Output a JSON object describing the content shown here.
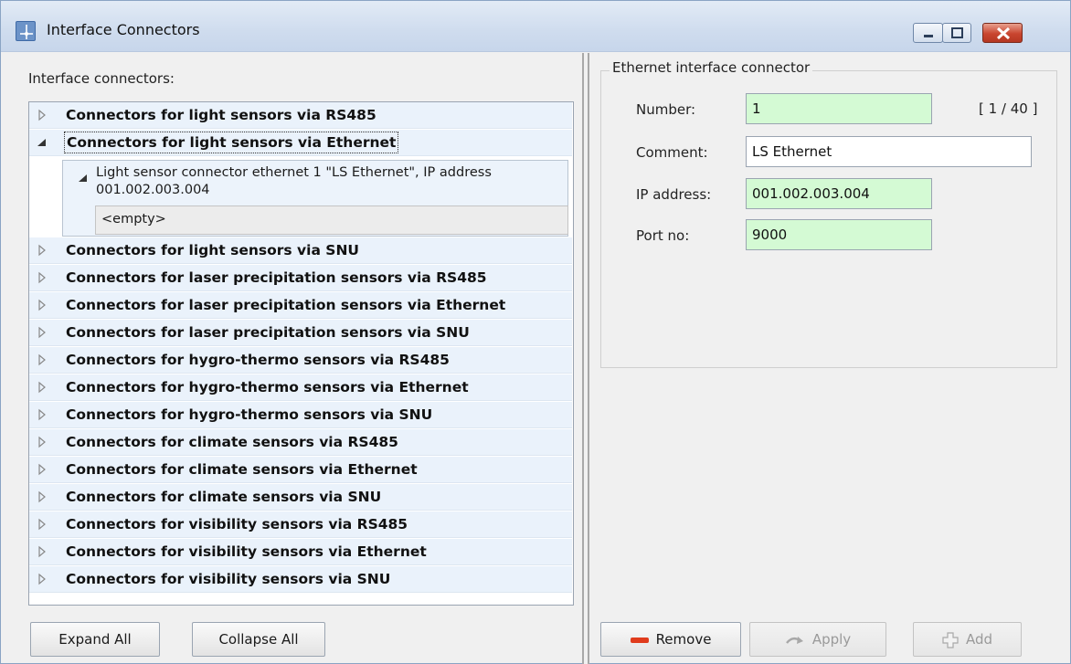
{
  "window": {
    "title": "Interface Connectors",
    "controls": [
      "minimize",
      "maximize",
      "close"
    ]
  },
  "left": {
    "label": "Interface connectors:",
    "tree": [
      {
        "label": "Connectors for light sensors via RS485",
        "expanded": false
      },
      {
        "label": "Connectors for light sensors via Ethernet",
        "expanded": true,
        "selected": true
      },
      {
        "label": "Connectors for light sensors via SNU",
        "expanded": false
      },
      {
        "label": "Connectors for laser precipitation sensors via RS485",
        "expanded": false
      },
      {
        "label": "Connectors for laser precipitation sensors via Ethernet",
        "expanded": false
      },
      {
        "label": "Connectors for laser precipitation sensors via SNU",
        "expanded": false
      },
      {
        "label": "Connectors for hygro-thermo sensors via RS485",
        "expanded": false
      },
      {
        "label": "Connectors for hygro-thermo sensors via Ethernet",
        "expanded": false
      },
      {
        "label": "Connectors for hygro-thermo sensors via SNU",
        "expanded": false
      },
      {
        "label": "Connectors for climate sensors via RS485",
        "expanded": false
      },
      {
        "label": "Connectors for climate sensors via Ethernet",
        "expanded": false
      },
      {
        "label": "Connectors for climate sensors via SNU",
        "expanded": false
      },
      {
        "label": "Connectors for visibility sensors via RS485",
        "expanded": false
      },
      {
        "label": "Connectors for visibility sensors via Ethernet",
        "expanded": false
      },
      {
        "label": "Connectors for visibility sensors via SNU",
        "expanded": false
      }
    ],
    "child": {
      "label": "Light sensor connector ethernet 1 \"LS Ethernet\", IP address 001.002.003.004",
      "empty_label": "<empty>"
    },
    "buttons": {
      "expand_all": "Expand All",
      "collapse_all": "Collapse All"
    }
  },
  "right": {
    "group_title": "Ethernet interface connector",
    "fields": {
      "number_label": "Number:",
      "number_value": "1",
      "counter": "[ 1 / 40 ]",
      "comment_label": "Comment:",
      "comment_value": "LS Ethernet",
      "ip_label": "IP address:",
      "ip_value": "001.002.003.004",
      "port_label": "Port no:",
      "port_value": "9000"
    },
    "buttons": {
      "remove": "Remove",
      "apply": "Apply",
      "add": "Add"
    },
    "colors": {
      "valid_field": "#d4fad4",
      "remove_icon": "#e03b1c"
    }
  }
}
